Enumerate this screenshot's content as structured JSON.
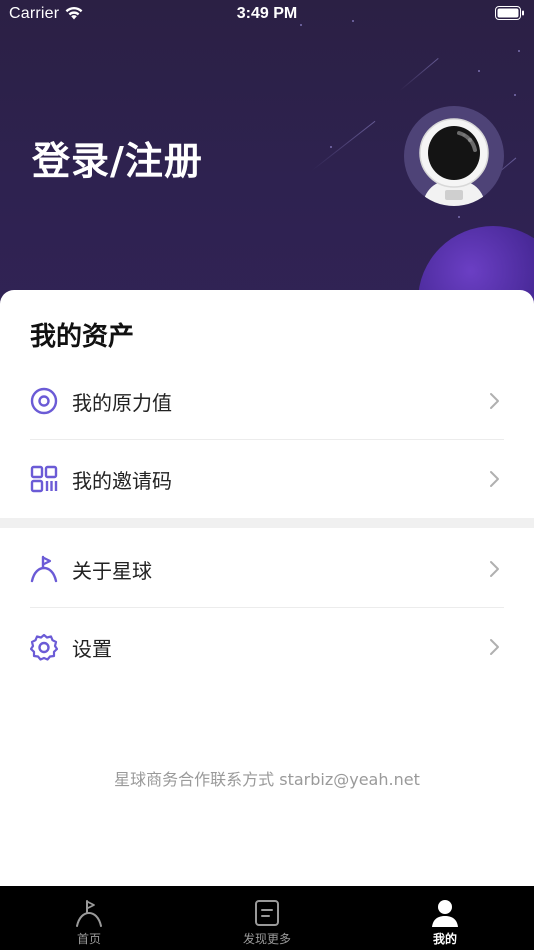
{
  "status_bar": {
    "carrier": "Carrier",
    "time": "3:49 PM"
  },
  "header": {
    "login_label": "登录/注册",
    "avatar_icon": "astronaut-icon"
  },
  "assets": {
    "title": "我的资产",
    "items": [
      {
        "label": "我的原力值",
        "icon": "force-value-icon"
      },
      {
        "label": "我的邀请码",
        "icon": "qr-code-icon"
      }
    ]
  },
  "more": {
    "items": [
      {
        "label": "关于星球",
        "icon": "planet-flag-icon"
      },
      {
        "label": "设置",
        "icon": "gear-icon"
      }
    ]
  },
  "footer": {
    "contact": "星球商务合作联系方式 starbiz@yeah.net"
  },
  "tab_bar": {
    "tabs": [
      {
        "label": "首页",
        "icon": "planet-flag-icon",
        "active": false
      },
      {
        "label": "发现更多",
        "icon": "document-icon",
        "active": false
      },
      {
        "label": "我的",
        "icon": "person-icon",
        "active": true
      }
    ]
  },
  "colors": {
    "header_bg": "#2e2250",
    "accent": "#6b5bd6",
    "chevron": "#b0b0b0",
    "tab_bar_bg": "#000000"
  }
}
